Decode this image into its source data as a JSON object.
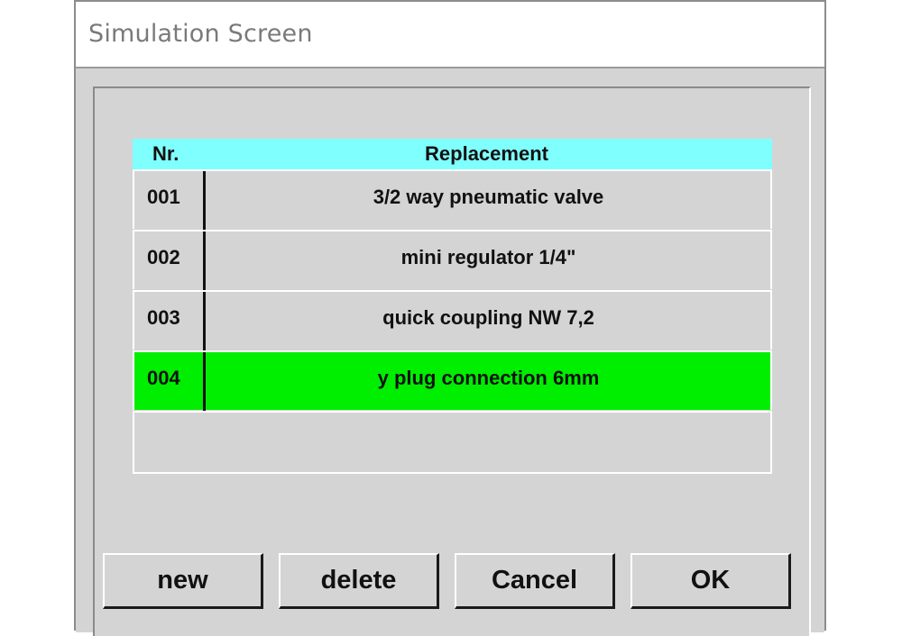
{
  "window": {
    "title": "Simulation Screen"
  },
  "table": {
    "headers": {
      "nr": "Nr.",
      "replacement": "Replacement"
    },
    "rows": [
      {
        "nr": "001",
        "replacement": "3/2 way pneumatic valve",
        "selected": false
      },
      {
        "nr": "002",
        "replacement": "mini regulator 1/4\"",
        "selected": false
      },
      {
        "nr": "003",
        "replacement": "quick coupling NW 7,2",
        "selected": false
      },
      {
        "nr": "004",
        "replacement": "y plug connection 6mm",
        "selected": true
      }
    ],
    "header_color": "#80ffff",
    "selected_color": "#00ee00"
  },
  "buttons": {
    "new": "new",
    "delete": "delete",
    "cancel": "Cancel",
    "ok": "OK"
  }
}
